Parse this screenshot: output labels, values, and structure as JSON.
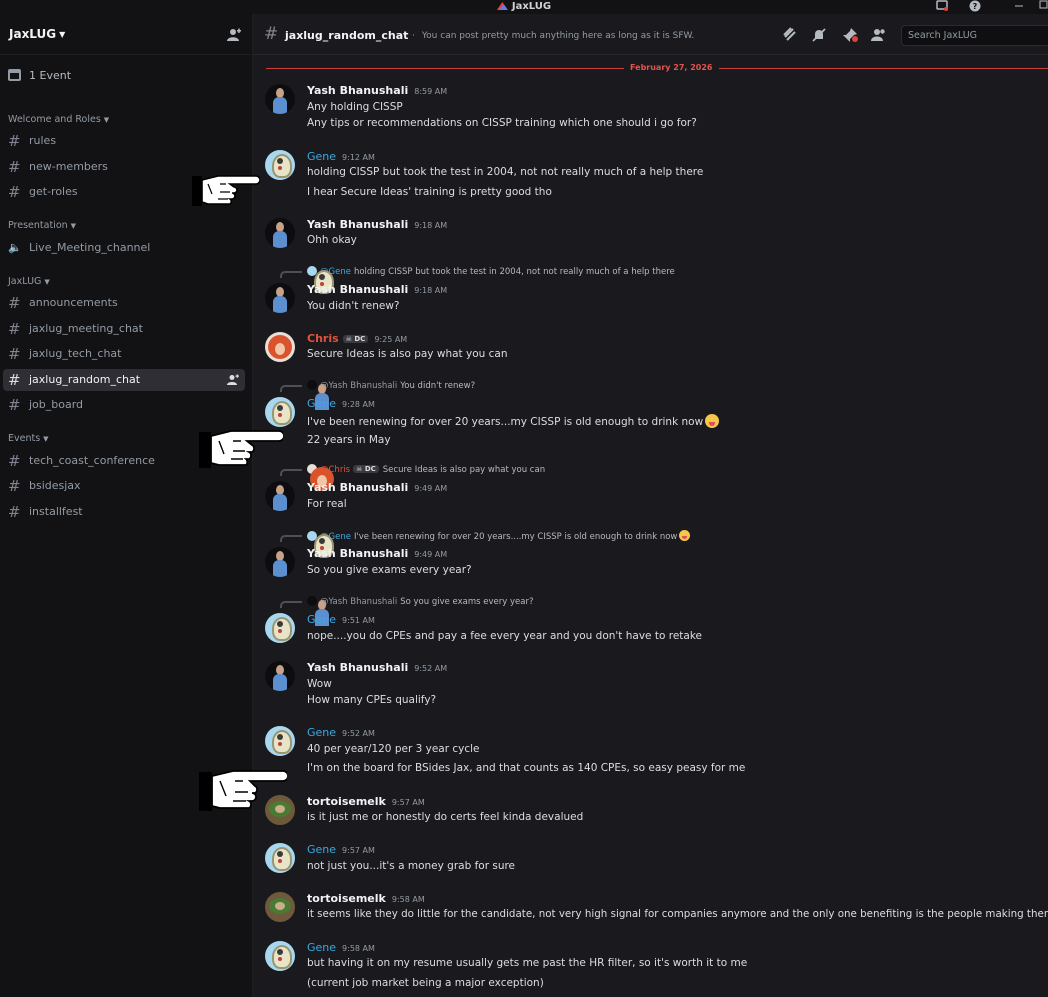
{
  "window": {
    "title": "JaxLUG"
  },
  "server": {
    "name": "JaxLUG",
    "events_label": "1 Event"
  },
  "sidebar": {
    "categories": [
      {
        "label": "Welcome and Roles"
      },
      {
        "label": "Presentation"
      },
      {
        "label": "JaxLUG"
      },
      {
        "label": "Events"
      }
    ],
    "channels": [
      {
        "label": "rules"
      },
      {
        "label": "new-members"
      },
      {
        "label": "get-roles"
      },
      {
        "label": "Live_Meeting_channel"
      },
      {
        "label": "announcements"
      },
      {
        "label": "jaxlug_meeting_chat"
      },
      {
        "label": "jaxlug_tech_chat"
      },
      {
        "label": "jaxlug_random_chat"
      },
      {
        "label": "job_board"
      },
      {
        "label": "tech_coast_conference"
      },
      {
        "label": "bsidesjax"
      },
      {
        "label": "installfest"
      }
    ],
    "active_channel": "jaxlug_random_chat"
  },
  "header": {
    "channel": "jaxlug_random_chat",
    "topic": "You can post pretty much anything here as long as it is SFW.",
    "search_placeholder": "Search JaxLUG"
  },
  "date_divider": "February 27, 2026",
  "messages": [
    {
      "author": "Yash Bhanushali",
      "time": "8:59 AM",
      "lines": [
        "Any holding CISSP",
        "Any tips or recommendations on CISSP training which one should i go for?"
      ]
    },
    {
      "author": "Gene",
      "time": "9:12 AM",
      "lines": [
        "holding CISSP but took the test in 2004, not not really much of a help there",
        "I hear Secure Ideas' training is pretty good tho"
      ]
    },
    {
      "author": "Yash Bhanushali",
      "time": "9:18 AM",
      "lines": [
        "Ohh okay"
      ]
    },
    {
      "reply_to": "@Gene",
      "reply_text": "holding CISSP but took the test in 2004, not not really much of a help there",
      "author": "Yash Bhanushali",
      "time": "9:18 AM",
      "lines": [
        "You didn't renew?"
      ]
    },
    {
      "author": "Chris",
      "badge": "DC",
      "time": "9:25 AM",
      "lines": [
        "Secure Ideas is also pay what you can"
      ]
    },
    {
      "reply_to": "@Yash Bhanushali",
      "reply_text": "You didn't renew?",
      "author": "Gene",
      "time": "9:28 AM",
      "lines": [
        "I've been renewing for over 20 years...my CISSP is old enough to drink now",
        "22 years in May"
      ]
    },
    {
      "reply_to": "@Chris",
      "reply_badge": "DC",
      "reply_text": "Secure Ideas is also pay what you can",
      "author": "Yash Bhanushali",
      "time": "9:49 AM",
      "lines": [
        "For real"
      ]
    },
    {
      "reply_to": "@Gene",
      "reply_text": "I've been renewing for over 20 years....my CISSP is old enough to drink now",
      "author": "Yash Bhanushali",
      "time": "9:49 AM",
      "lines": [
        "So you give exams every year?"
      ]
    },
    {
      "reply_to": "@Yash Bhanushali",
      "reply_text": "So you give exams every year?",
      "author": "Gene",
      "time": "9:51 AM",
      "lines": [
        "nope....you do CPEs and pay a fee every year and you don't have to retake"
      ]
    },
    {
      "author": "Yash Bhanushali",
      "time": "9:52 AM",
      "lines": [
        "Wow",
        "How many CPEs qualify?"
      ]
    },
    {
      "author": "Gene",
      "time": "9:52 AM",
      "lines": [
        "40 per year/120 per 3 year cycle",
        "I'm on the board for BSides Jax, and that counts as 140 CPEs, so easy peasy for me"
      ]
    },
    {
      "author": "tortoisemelk",
      "time": "9:57 AM",
      "lines": [
        "is it just me or honestly do certs feel kinda devalued"
      ]
    },
    {
      "author": "Gene",
      "time": "9:57 AM",
      "lines": [
        "not just you...it's a money grab for sure"
      ]
    },
    {
      "author": "tortoisemelk",
      "time": "9:58 AM",
      "lines": [
        "it seems like they do little for the candidate, not very high signal for companies anymore and the only one benefiting is the people making them"
      ]
    },
    {
      "author": "Gene",
      "time": "9:58 AM",
      "lines": [
        "but having it on my resume usually gets me past the HR filter, so it's worth it to me",
        "(current job market being a major exception)"
      ]
    }
  ],
  "colors": {
    "accent": "#3ea8e0",
    "danger": "#c9403d",
    "chris": "#e0533a"
  },
  "icons": [
    "calendar-icon",
    "hash-icon",
    "speaker-icon",
    "threads-icon",
    "mute-icon",
    "pin-icon",
    "members-icon",
    "help-icon",
    "pointing-hand-icon"
  ]
}
